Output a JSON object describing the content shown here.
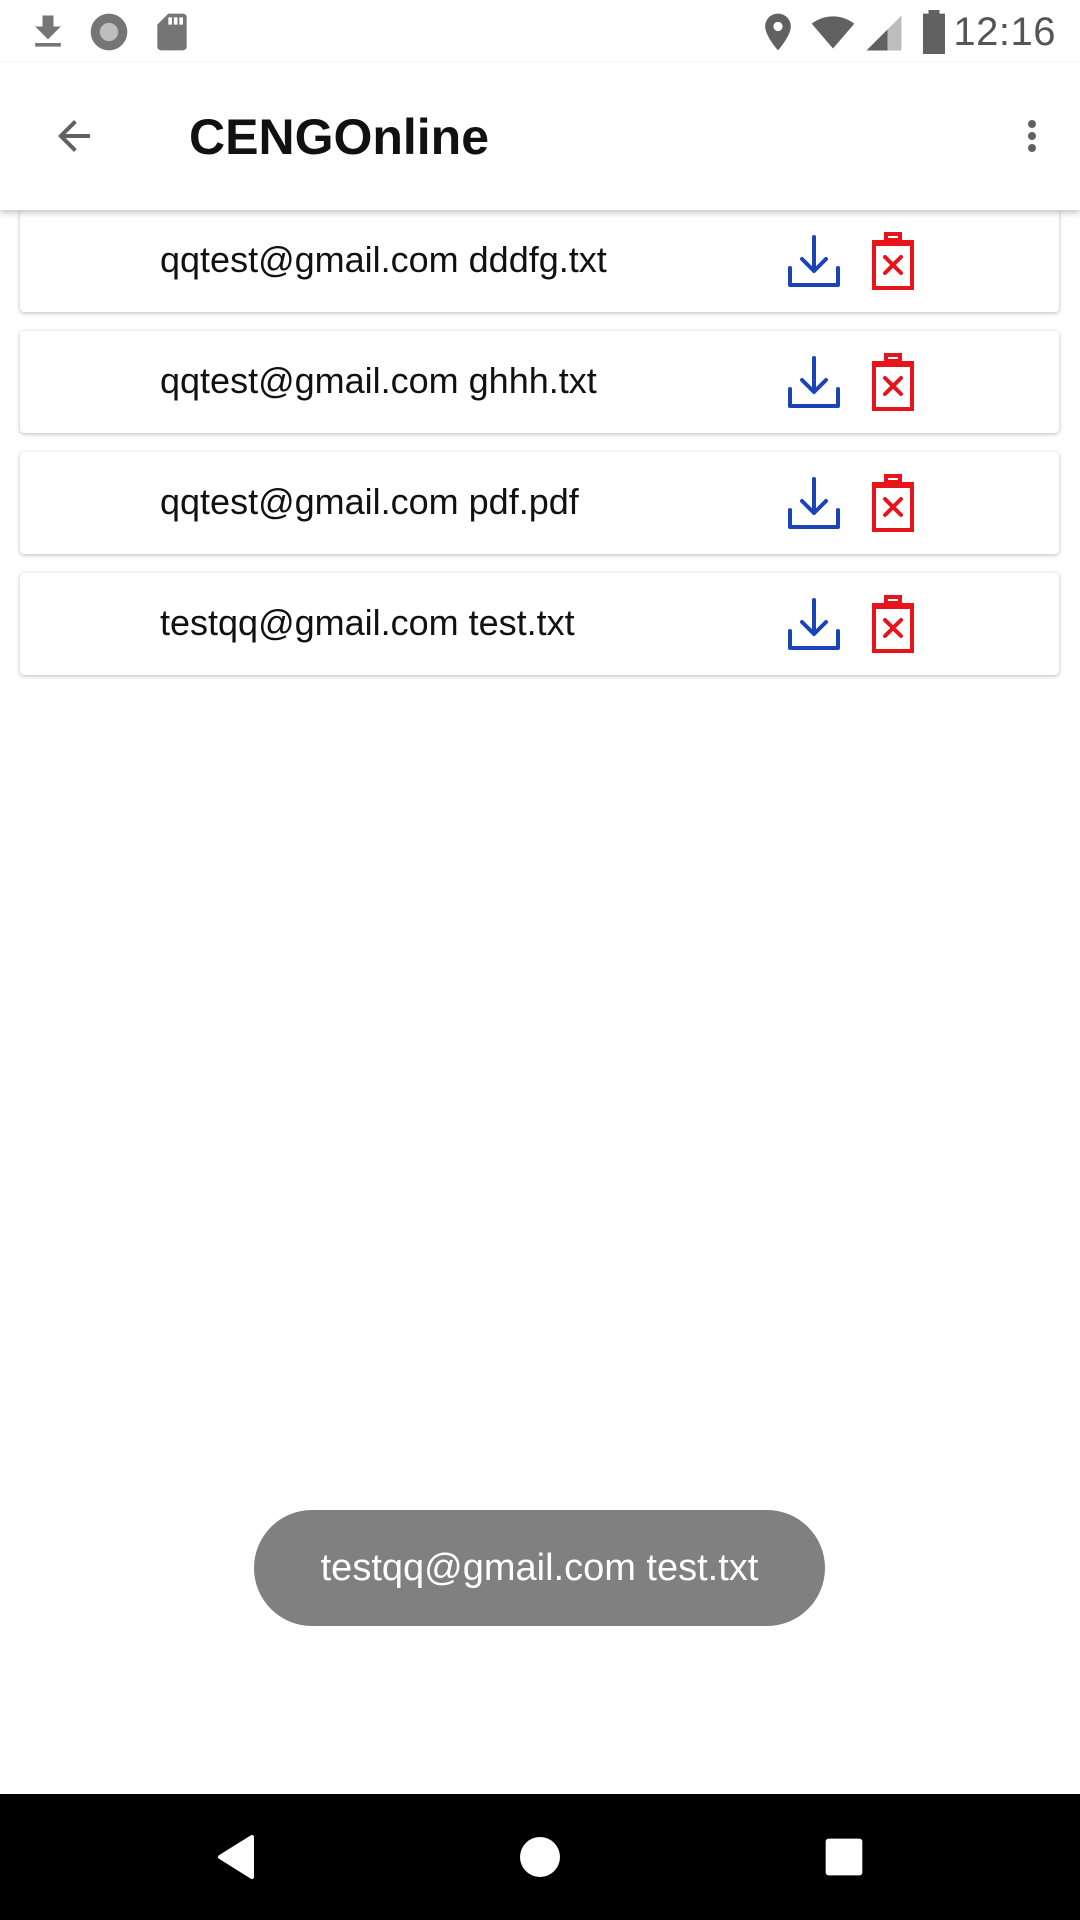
{
  "status_bar": {
    "time": "12:16",
    "icons": [
      "download-icon",
      "record-icon",
      "sd-card-icon",
      "location-icon",
      "wifi-icon",
      "signal-icon",
      "battery-icon"
    ]
  },
  "app_bar": {
    "title": "CENGOnline",
    "back_icon": "arrow-back-icon",
    "menu_icon": "more-vert-icon"
  },
  "files": [
    {
      "label": "qqtest@gmail.com dddfg.txt"
    },
    {
      "label": "qqtest@gmail.com ghhh.txt"
    },
    {
      "label": "qqtest@gmail.com pdf.pdf"
    },
    {
      "label": "testqq@gmail.com test.txt"
    }
  ],
  "toast": {
    "text": "testqq@gmail.com test.txt"
  },
  "nav_bar": {
    "icons": [
      "nav-back-icon",
      "nav-home-icon",
      "nav-recents-icon"
    ]
  },
  "colors": {
    "download": "#1a44b8",
    "delete": "#e8141b",
    "toast_bg": "#808080",
    "nav_bg": "#000000"
  }
}
